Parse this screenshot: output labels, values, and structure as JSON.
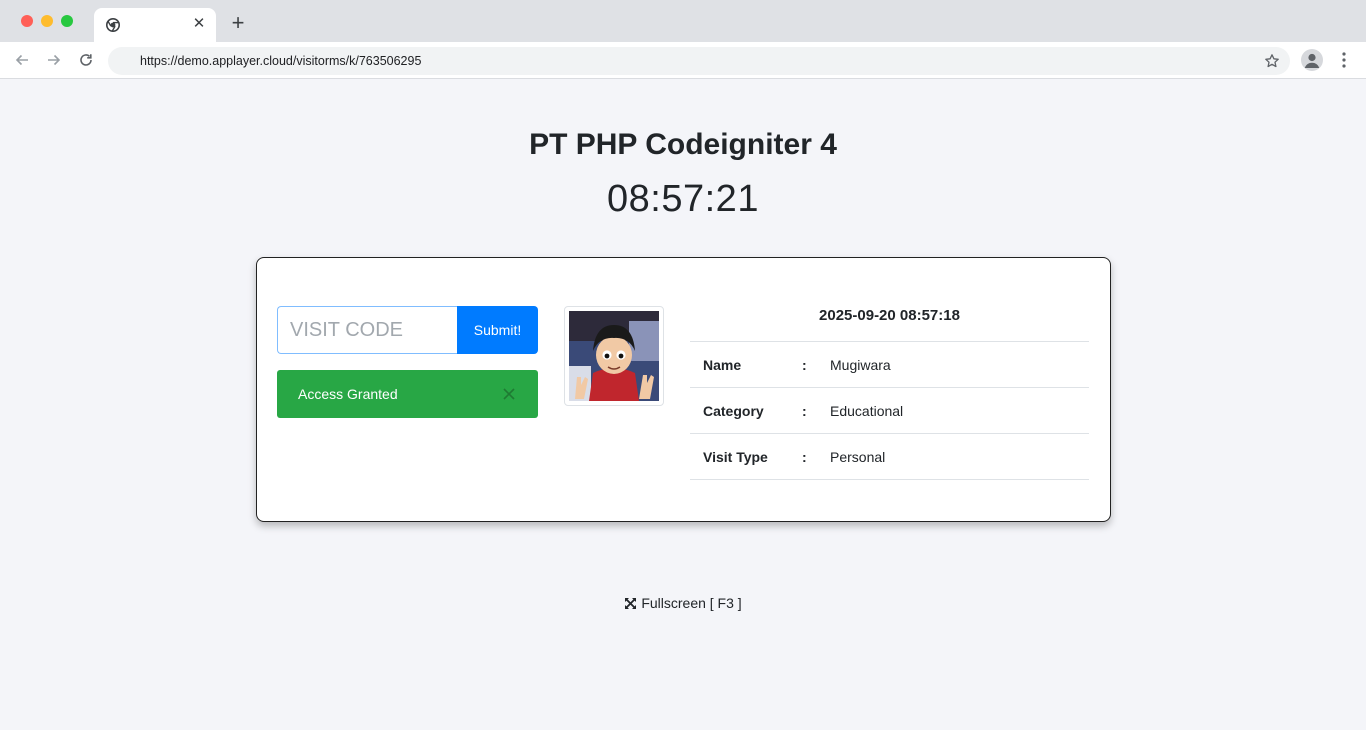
{
  "browser": {
    "url": "https://demo.applayer.cloud/visitorms/k/763506295",
    "tab_close_glyph": "✕",
    "new_tab_glyph": "+"
  },
  "page": {
    "title": "PT PHP Codeigniter 4",
    "clock": "08:57:21"
  },
  "form": {
    "placeholder": "VISIT CODE",
    "submit_label": "Submit!",
    "alert_text": "Access Granted"
  },
  "visitor": {
    "datetime": "2025-09-20 08:57:18",
    "rows": [
      {
        "label": "Name",
        "sep": ":",
        "value": "Mugiwara"
      },
      {
        "label": "Category",
        "sep": ":",
        "value": "Educational"
      },
      {
        "label": "Visit Type",
        "sep": ":",
        "value": "Personal"
      }
    ]
  },
  "footer": {
    "fullscreen_label": "Fullscreen [ F3 ]"
  },
  "colors": {
    "page_bg": "#f4f5f9",
    "primary": "#007bff",
    "success": "#28a745",
    "input_border": "#80bdff"
  },
  "icons": [
    "back-arrow-icon",
    "forward-arrow-icon",
    "reload-icon",
    "star-icon",
    "profile-icon",
    "kebab-menu-icon",
    "chrome-favicon",
    "close-icon",
    "expand-icon"
  ]
}
